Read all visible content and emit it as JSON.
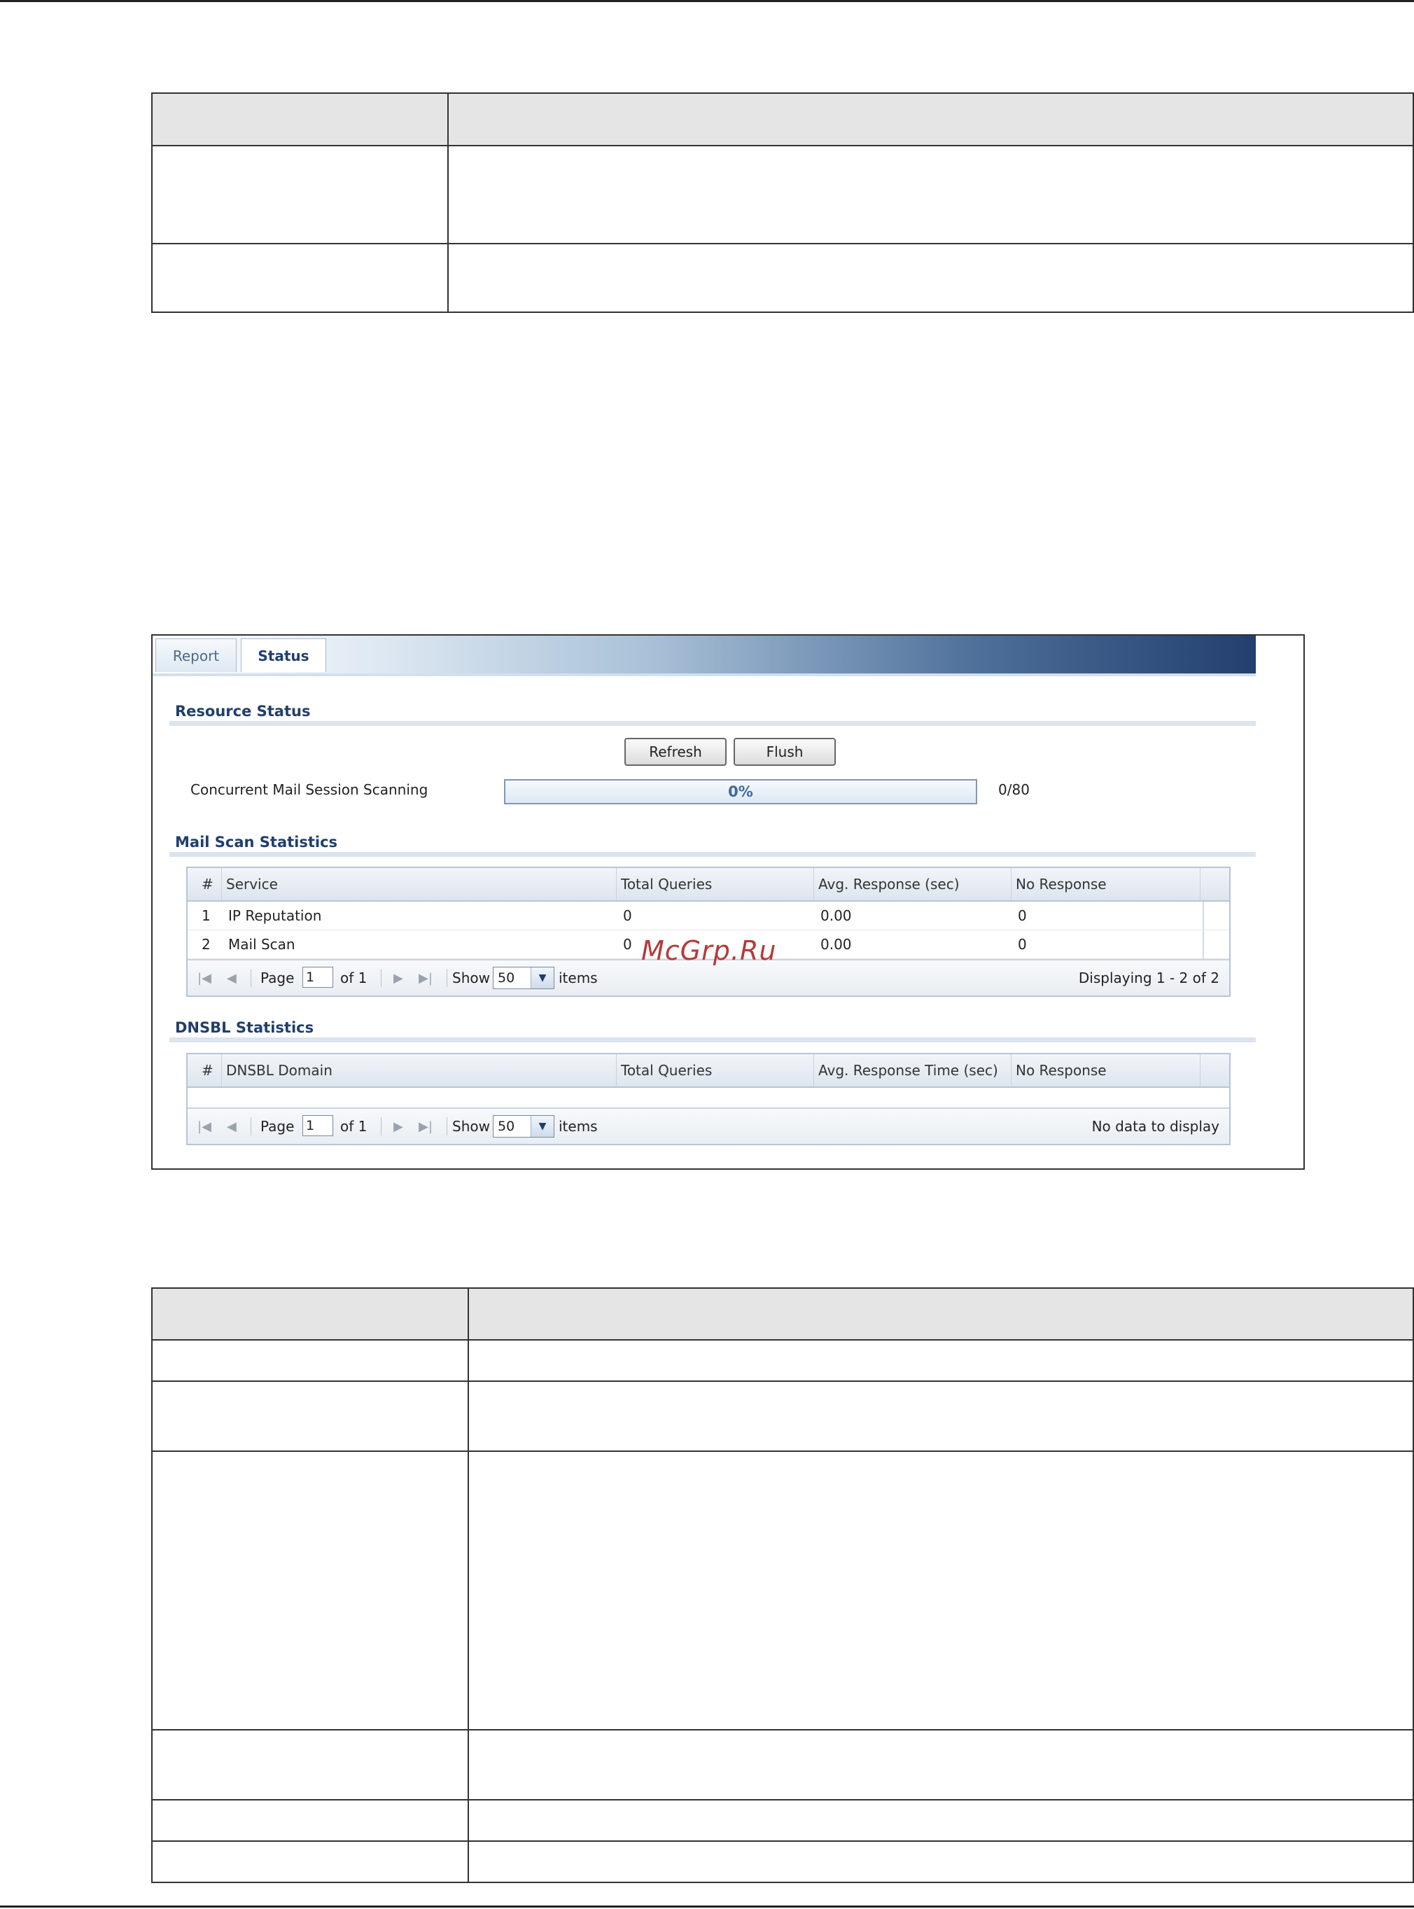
{
  "tabs": [
    {
      "label": "Report",
      "active": false
    },
    {
      "label": "Status",
      "active": true
    }
  ],
  "resource_status": {
    "title": "Resource Status",
    "refresh_label": "Refresh",
    "flush_label": "Flush",
    "scanning_label": "Concurrent Mail Session Scanning",
    "progress_text": "0%",
    "progress_value": 0,
    "count_text": "0/80"
  },
  "mail_scan": {
    "title": "Mail Scan Statistics",
    "columns": [
      "#",
      "Service",
      "Total Queries",
      "Avg. Response (sec)",
      "No Response"
    ],
    "rows": [
      {
        "num": "1",
        "service": "IP Reputation",
        "total_queries": "0",
        "avg_response": "0.00",
        "no_response": "0"
      },
      {
        "num": "2",
        "service": "Mail Scan",
        "total_queries": "0",
        "avg_response": "0.00",
        "no_response": "0"
      }
    ],
    "pager": {
      "page_label": "Page",
      "page_value": "1",
      "of_label": "of 1",
      "show_label": "Show",
      "show_value": "50",
      "items_label": "items",
      "status": "Displaying 1 - 2 of 2"
    }
  },
  "dnsbl": {
    "title": "DNSBL Statistics",
    "columns": [
      "#",
      "DNSBL Domain",
      "Total Queries",
      "Avg. Response Time (sec)",
      "No Response"
    ],
    "pager": {
      "page_label": "Page",
      "page_value": "1",
      "of_label": "of 1",
      "show_label": "Show",
      "show_value": "50",
      "items_label": "items",
      "status": "No data to display"
    }
  },
  "watermark": "McGrp.Ru"
}
